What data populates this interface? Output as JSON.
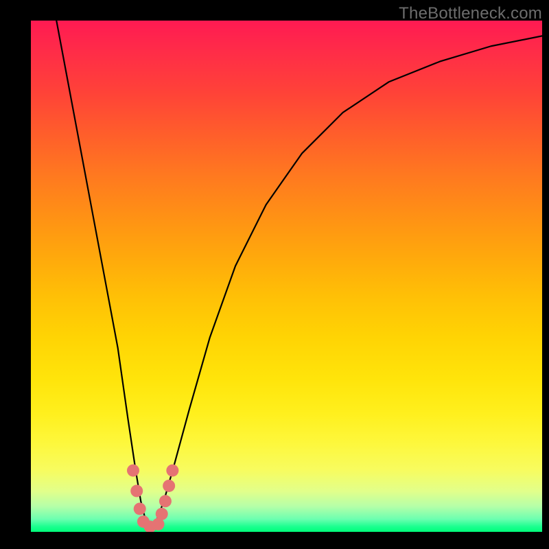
{
  "watermark": "TheBottleneck.com",
  "chart_data": {
    "type": "line",
    "title": "",
    "xlabel": "",
    "ylabel": "",
    "xlim": [
      0,
      100
    ],
    "ylim": [
      0,
      100
    ],
    "series": [
      {
        "name": "bottleneck-curve",
        "x": [
          5,
          8,
          11,
          14,
          17,
          19,
          20.5,
          21.5,
          22.5,
          23.5,
          24.5,
          26,
          28,
          31,
          35,
          40,
          46,
          53,
          61,
          70,
          80,
          90,
          100
        ],
        "y": [
          100,
          84,
          68,
          52,
          36,
          22,
          12,
          6,
          2,
          1,
          2,
          6,
          13,
          24,
          38,
          52,
          64,
          74,
          82,
          88,
          92,
          95,
          97
        ]
      }
    ],
    "markers": {
      "name": "highlight-dots",
      "color": "#e57373",
      "points": [
        {
          "x": 20.0,
          "y": 12
        },
        {
          "x": 20.7,
          "y": 8
        },
        {
          "x": 21.3,
          "y": 4.5
        },
        {
          "x": 22.0,
          "y": 2
        },
        {
          "x": 23.3,
          "y": 1
        },
        {
          "x": 24.9,
          "y": 1.5
        },
        {
          "x": 25.6,
          "y": 3.5
        },
        {
          "x": 26.3,
          "y": 6
        },
        {
          "x": 27.0,
          "y": 9
        },
        {
          "x": 27.7,
          "y": 12
        }
      ]
    },
    "gradient_stops": [
      {
        "pos": 0,
        "color": "#ff1a52"
      },
      {
        "pos": 0.45,
        "color": "#ffae0a"
      },
      {
        "pos": 0.8,
        "color": "#fff226"
      },
      {
        "pos": 1.0,
        "color": "#00ff7a"
      }
    ]
  }
}
